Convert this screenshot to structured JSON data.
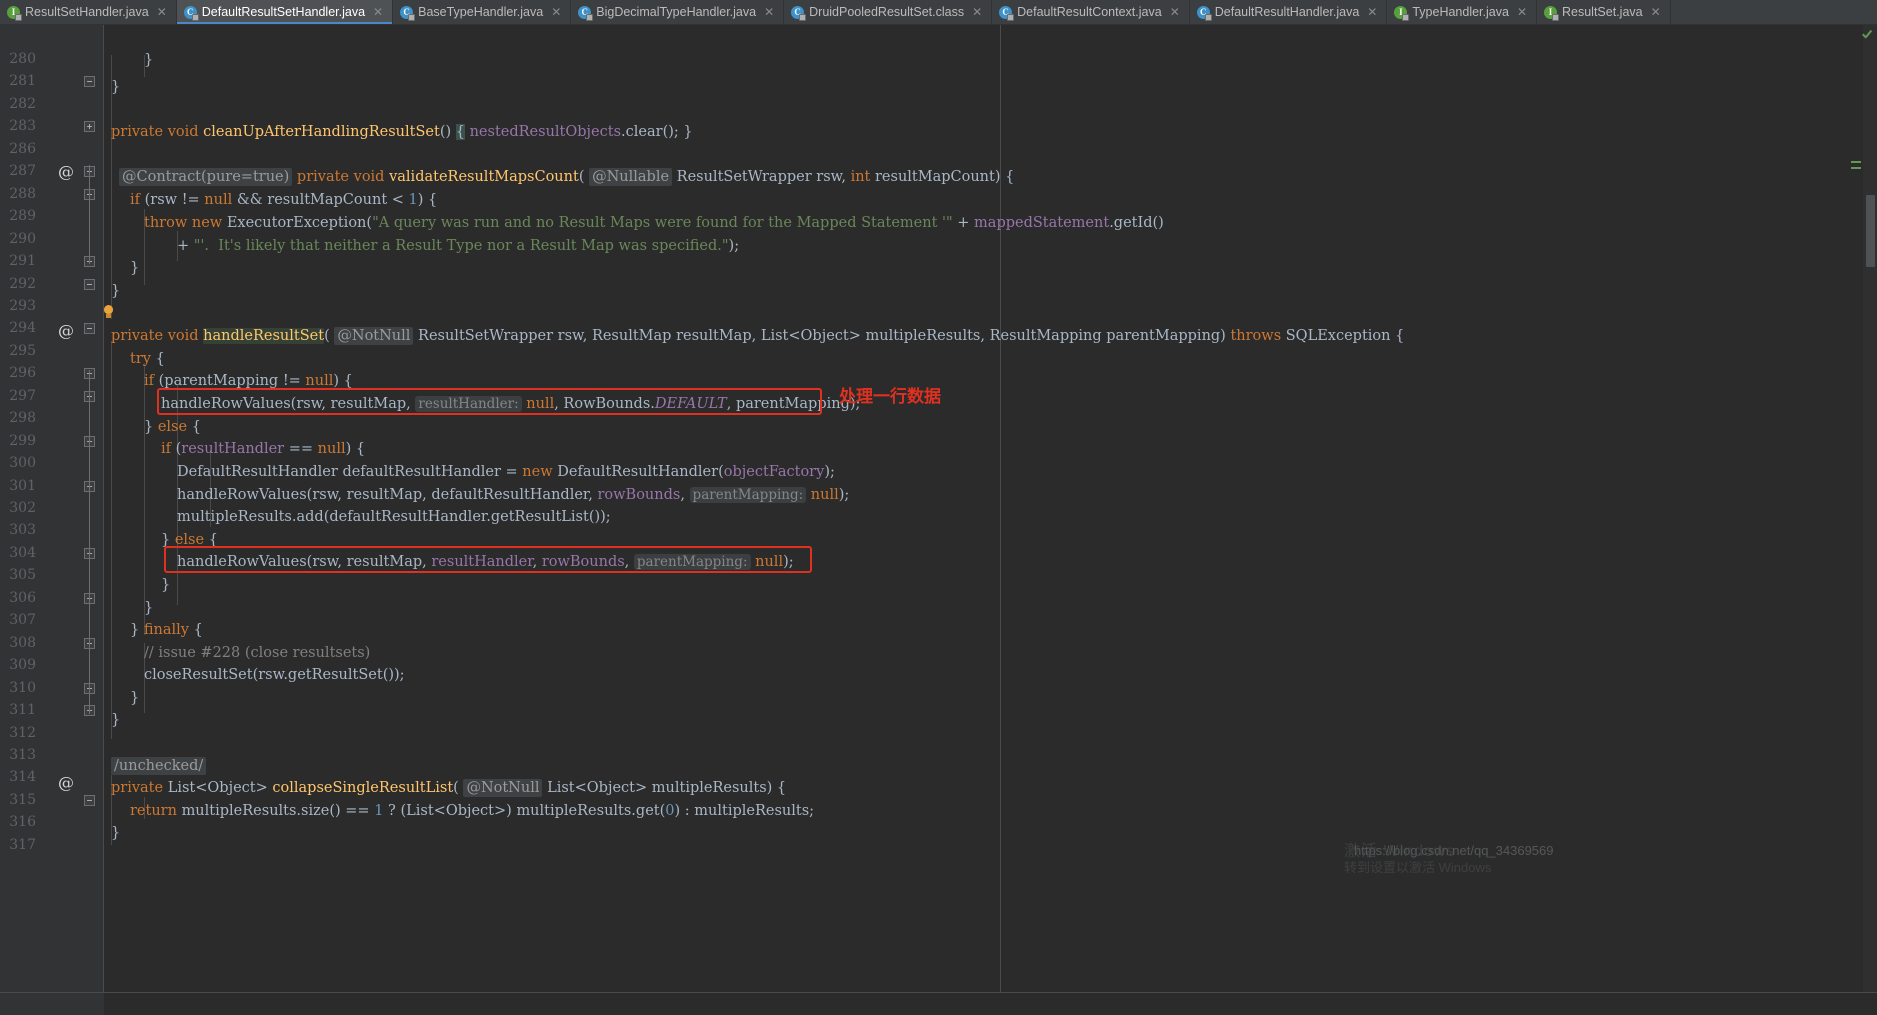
{
  "window": {
    "theme": "IntelliJ Darcula",
    "accent_color": "#4a88c7",
    "background": "#2b2b2b",
    "gutter_background": "#313335"
  },
  "tabs": [
    {
      "label": "ResultSetHandler.java",
      "icon": "interface-icon",
      "glyph": "I",
      "kind": "itf",
      "active": false
    },
    {
      "label": "DefaultResultSetHandler.java",
      "icon": "class-icon",
      "glyph": "C",
      "kind": "cls",
      "active": true
    },
    {
      "label": "BaseTypeHandler.java",
      "icon": "class-icon",
      "glyph": "C",
      "kind": "cls",
      "active": false
    },
    {
      "label": "BigDecimalTypeHandler.java",
      "icon": "class-icon",
      "glyph": "C",
      "kind": "cls",
      "active": false
    },
    {
      "label": "DruidPooledResultSet.class",
      "icon": "class-icon",
      "glyph": "C",
      "kind": "cls",
      "active": false
    },
    {
      "label": "DefaultResultContext.java",
      "icon": "class-icon",
      "glyph": "C",
      "kind": "cls",
      "active": false
    },
    {
      "label": "DefaultResultHandler.java",
      "icon": "class-icon",
      "glyph": "C",
      "kind": "cls",
      "active": false
    },
    {
      "label": "TypeHandler.java",
      "icon": "interface-icon",
      "glyph": "I",
      "kind": "itf",
      "active": false
    },
    {
      "label": "ResultSet.java",
      "icon": "interface-icon",
      "glyph": "I",
      "kind": "itf",
      "active": false
    }
  ],
  "tab_close_glyph": "✕",
  "editor": {
    "line_numbers": [
      280,
      281,
      282,
      283,
      286,
      287,
      288,
      289,
      290,
      291,
      292,
      293,
      294,
      295,
      296,
      297,
      298,
      299,
      300,
      301,
      302,
      303,
      304,
      305,
      306,
      307,
      308,
      309,
      310,
      311,
      312,
      313,
      314,
      315,
      316,
      317
    ],
    "lines": {
      "280": "}",
      "281": "}",
      "282": "",
      "283": "private void cleanUpAfterHandlingResultSet() { nestedResultObjects.clear(); }",
      "286": "",
      "287": "@Contract(pure=true) private void validateResultMapsCount( @Nullable ResultSetWrapper rsw, int resultMapCount) {",
      "288": "if (rsw != null && resultMapCount < 1) {",
      "289": "throw new ExecutorException(\"A query was run and no Result Maps were found for the Mapped Statement '\" + mappedStatement.getId()",
      "290": "+ \"'.  It's likely that neither a Result Type nor a Result Map was specified.\");",
      "291": "}",
      "292": "}",
      "293": "",
      "294": "private void handleResultSet( @NotNull ResultSetWrapper rsw, ResultMap resultMap, List<Object> multipleResults, ResultMapping parentMapping) throws SQLException {",
      "295": "try {",
      "296": "if (parentMapping != null) {",
      "297": "handleRowValues(rsw, resultMap, resultHandler: null, RowBounds.DEFAULT, parentMapping);",
      "298": "} else {",
      "299": "if (resultHandler == null) {",
      "300": "DefaultResultHandler defaultResultHandler = new DefaultResultHandler(objectFactory);",
      "301": "handleRowValues(rsw, resultMap, defaultResultHandler, rowBounds, parentMapping: null);",
      "302": "multipleResults.add(defaultResultHandler.getResultList());",
      "303": "} else {",
      "304": "handleRowValues(rsw, resultMap, resultHandler, rowBounds, parentMapping: null);",
      "305": "}",
      "306": "}",
      "307": "} finally {",
      "308": "// issue #228 (close resultsets)",
      "309": "closeResultSet(rsw.getResultSet());",
      "310": "}",
      "311": "}",
      "312": "",
      "313": "/unchecked/",
      "314": "private List<Object> collapseSingleResultList( @NotNull List<Object> multipleResults) {",
      "315": "return multipleResults.size() == 1 ? (List<Object>) multipleResults.get(0) : multipleResults;",
      "316": "}",
      "317": ""
    },
    "annotation_markers": [
      "@",
      "@",
      "@"
    ],
    "caret_word": "handleResultSet",
    "parameter_hints": [
      "resultHandler:",
      "parentMapping:"
    ],
    "inline_annotations": [
      "@Contract(pure=true)",
      "@Nullable",
      "@NotNull"
    ]
  },
  "annotations": {
    "note_text": "处理一行数据",
    "note_color": "#e03020",
    "box_color": "#e03020",
    "boxes": 2
  },
  "watermark": {
    "url": "https://blog.csdn.net/qq_34369569",
    "secondary": "激活 Windows",
    "tertiary": "转到设置以激活 Windows"
  },
  "status": {
    "inspection_icon": "checkmark-ok-icon",
    "inspection_color": "#629755"
  }
}
